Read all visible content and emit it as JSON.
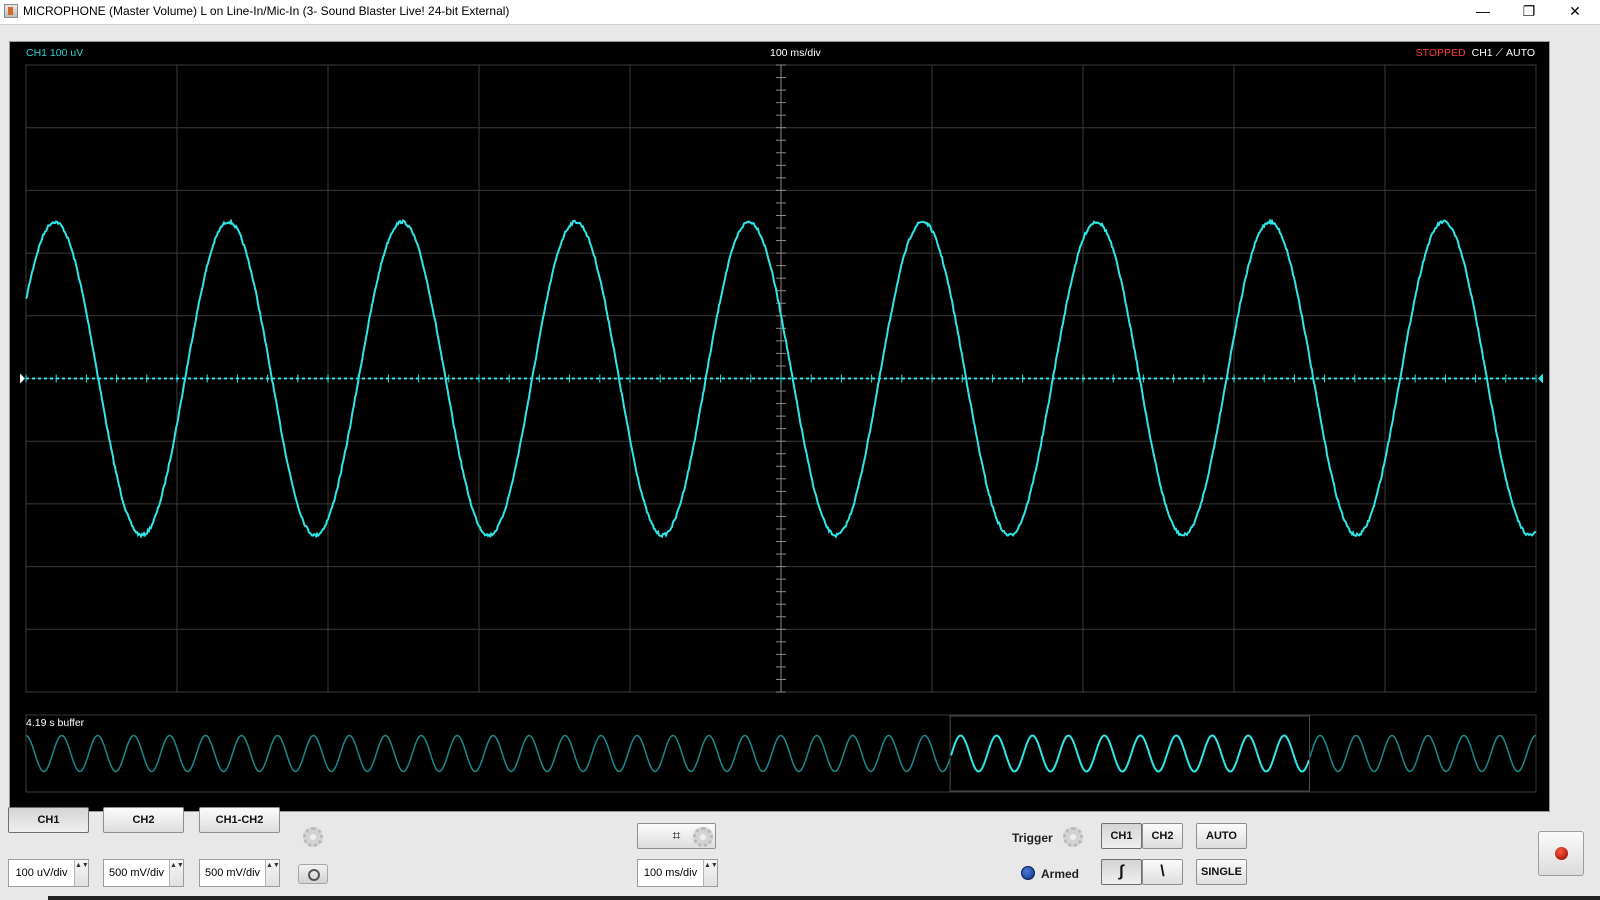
{
  "window": {
    "title": "MICROPHONE (Master Volume) L on Line-In/Mic-In (3- Sound Blaster Live! 24-bit External)",
    "minimize_glyph": "—",
    "maximize_glyph": "❐",
    "close_glyph": "✕"
  },
  "scope": {
    "channel_scale_label": "CH1 100 uV",
    "timebase_label": "100 ms/div",
    "status": "STOPPED",
    "trigger_channel": "CH1",
    "trigger_slope_glyph": "⟋",
    "trigger_mode": "AUTO",
    "trace_color": "#2ee6e6",
    "grid_color": "#3a3a3a",
    "grid_divisions": {
      "horizontal": 10,
      "vertical": 10
    },
    "waveform": {
      "shape": "sine",
      "cycles_on_screen": 8.7,
      "amplitude_divisions": 2.5,
      "phase_at_left_divisions": 1.25
    },
    "buffer_label": "4.19 s buffer",
    "buffer_overview": {
      "cycles_total": 42,
      "visible_window": [
        0.612,
        0.85
      ]
    }
  },
  "controls": {
    "ch1_label": "CH1",
    "ch2_label": "CH2",
    "ch1_minus_ch2_label": "CH1-CH2",
    "ch1_scale": "100 uV/div",
    "ch2_scale": "500 mV/div",
    "math_scale": "500 mV/div",
    "timebase_value": "100 ms/div",
    "grid_glyph": "⌗",
    "spinner_glyph": "▲▼",
    "trigger_label": "Trigger",
    "trigger_ch1": "CH1",
    "trigger_ch2": "CH2",
    "auto_label": "AUTO",
    "single_label": "SINGLE",
    "rising_glyph": "∫",
    "falling_glyph": "\\",
    "armed_label": "Armed"
  }
}
